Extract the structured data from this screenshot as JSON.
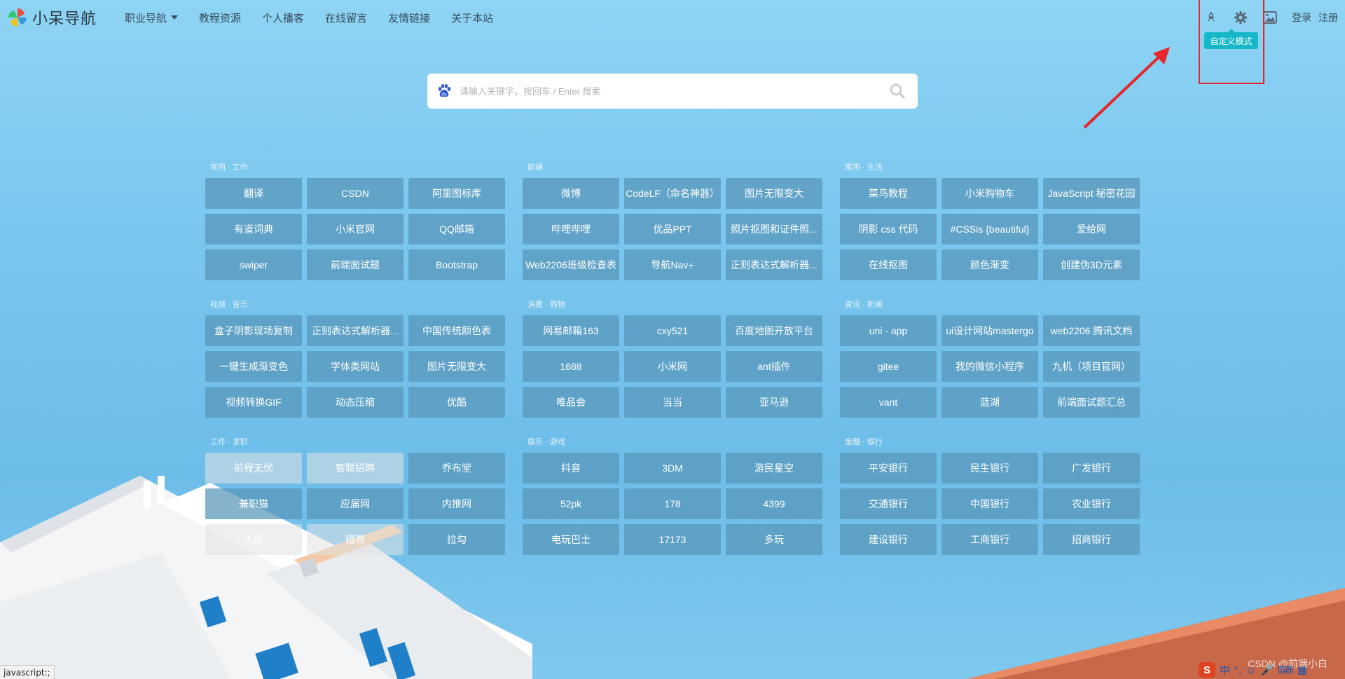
{
  "header": {
    "logo_text": "小呆导航",
    "nav": [
      {
        "label": "职业导航",
        "has_dropdown": true
      },
      {
        "label": "教程资源"
      },
      {
        "label": "个人播客"
      },
      {
        "label": "在线留言"
      },
      {
        "label": "友情链接"
      },
      {
        "label": "关于本站"
      }
    ],
    "right": {
      "icons": [
        "rocket-icon",
        "gear-icon",
        "image-icon"
      ],
      "login": "登录",
      "register": "注册",
      "tooltip": "自定义模式"
    }
  },
  "search": {
    "placeholder": "请输入关键字，按回车 / Enter 搜索",
    "engine_icon": "baidu-paw-icon"
  },
  "groups": [
    {
      "title": "常用 · 工作",
      "links": [
        "翻译",
        "CSDN",
        "阿里图标库",
        "有道词典",
        "小米官网",
        "QQ邮箱",
        "swiper",
        "前端面试题",
        "Bootstrap"
      ]
    },
    {
      "title": "前端",
      "links": [
        "微博",
        "CodeLF（命名神器）",
        "图片无限变大",
        "哔哩哔哩",
        "优品PPT",
        "照片抠图和证件照...",
        "Web2206班级检查表",
        "导航Nav+",
        "正则表达式解析器..."
      ]
    },
    {
      "title": "常用 · 生活",
      "links": [
        "菜鸟教程",
        "小米购物车",
        "JavaScript 秘密花园",
        "阴影 css 代码",
        "#CSSis {beautiful}",
        "爱给网",
        "在线抠图",
        "颜色渐变",
        "创建伪3D元素"
      ]
    },
    {
      "title": "视频 · 音乐",
      "links": [
        "盒子阴影现场复制",
        "正则表达式解析器...",
        "中国传统颜色表",
        "一键生成渐变色",
        "字体类网站",
        "图片无限变大",
        "视频转换GIF",
        "动态压缩",
        "优酷"
      ]
    },
    {
      "title": "消费 · 购物",
      "links": [
        "网易邮箱163",
        "cxy521",
        "百度地图开放平台",
        "1688",
        "小米网",
        "ant插件",
        "唯品会",
        "当当",
        "亚马逊"
      ]
    },
    {
      "title": "资讯 · 新闻",
      "links": [
        "uni - app",
        "ui设计网站mastergo",
        "web2206 腾讯文档",
        "gitee",
        "我的微信小程序",
        "九机（项目官网）",
        "vant",
        "蓝湖",
        "前端面试题汇总"
      ]
    },
    {
      "title": "工作 · 求职",
      "links": [
        "前程无忧",
        "智联招聘",
        "乔布堂",
        "兼职猫",
        "应届网",
        "内推网",
        "大街",
        "猎聘",
        "拉勾"
      ]
    },
    {
      "title": "娱乐 · 游戏",
      "links": [
        "抖音",
        "3DM",
        "游民星空",
        "52pk",
        "178",
        "4399",
        "电玩巴士",
        "17173",
        "多玩"
      ]
    },
    {
      "title": "金融 · 银行",
      "links": [
        "平安银行",
        "民生银行",
        "广发银行",
        "交通银行",
        "中国银行",
        "农业银行",
        "建设银行",
        "工商银行",
        "招商银行"
      ]
    }
  ],
  "statusbar": "javascript:;",
  "ime": {
    "s": "S",
    "lang": "中",
    "punct": "°,"
  },
  "watermark": "CSDN @前端小白"
}
